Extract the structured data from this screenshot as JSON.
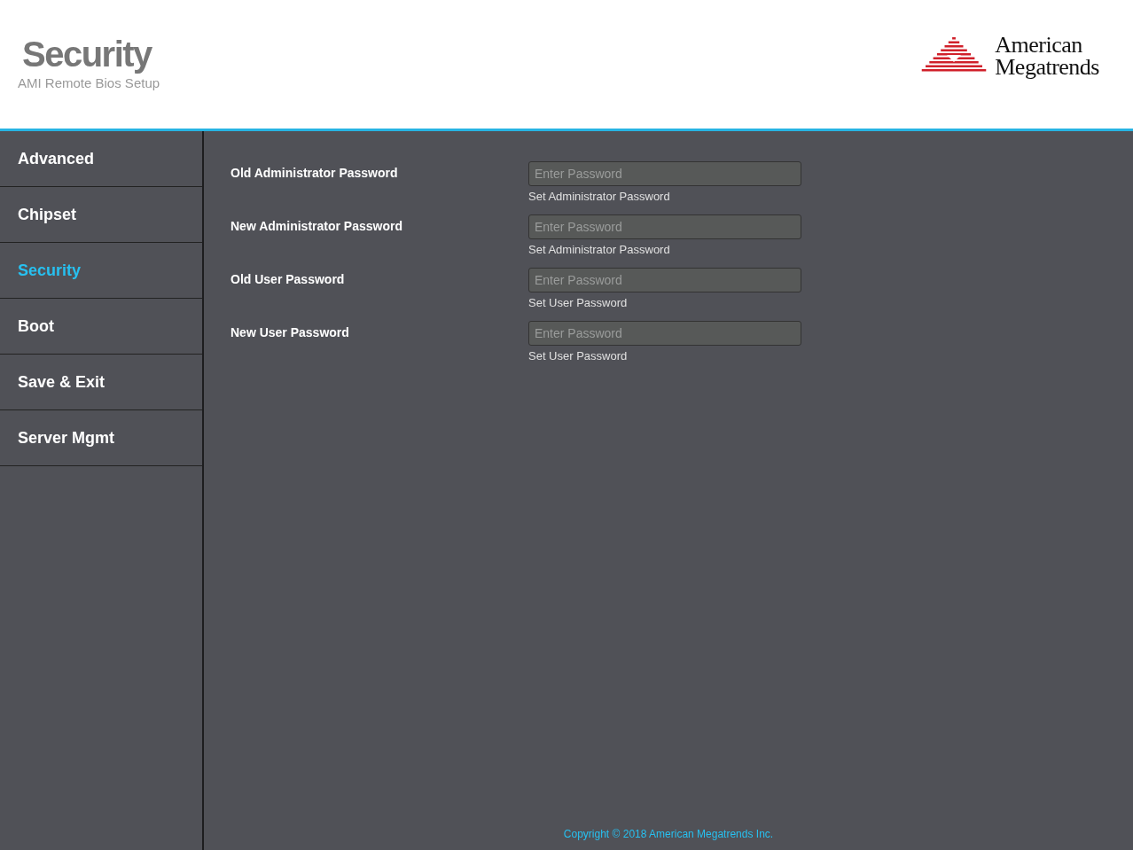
{
  "header": {
    "title": "Security",
    "subtitle": "AMI Remote Bios Setup",
    "logo": {
      "line_1": "American",
      "line_2": "Megatrends"
    }
  },
  "sidebar": {
    "items": [
      {
        "label": "Advanced",
        "selected": false
      },
      {
        "label": "Chipset",
        "selected": false
      },
      {
        "label": "Security",
        "selected": true
      },
      {
        "label": "Boot",
        "selected": false
      },
      {
        "label": "Save & Exit",
        "selected": false
      },
      {
        "label": "Server Mgmt",
        "selected": false
      }
    ]
  },
  "fields": [
    {
      "label": "Old Administrator Password",
      "placeholder": "Enter Password",
      "help": "Set Administrator Password"
    },
    {
      "label": "New Administrator Password",
      "placeholder": "Enter Password",
      "help": "Set Administrator Password"
    },
    {
      "label": "Old User Password",
      "placeholder": "Enter Password",
      "help": "Set User Password"
    },
    {
      "label": "New User Password",
      "placeholder": "Enter Password",
      "help": "Set User Password"
    }
  ],
  "footer": {
    "copyright": "Copyright © 2018 American Megatrends Inc."
  }
}
